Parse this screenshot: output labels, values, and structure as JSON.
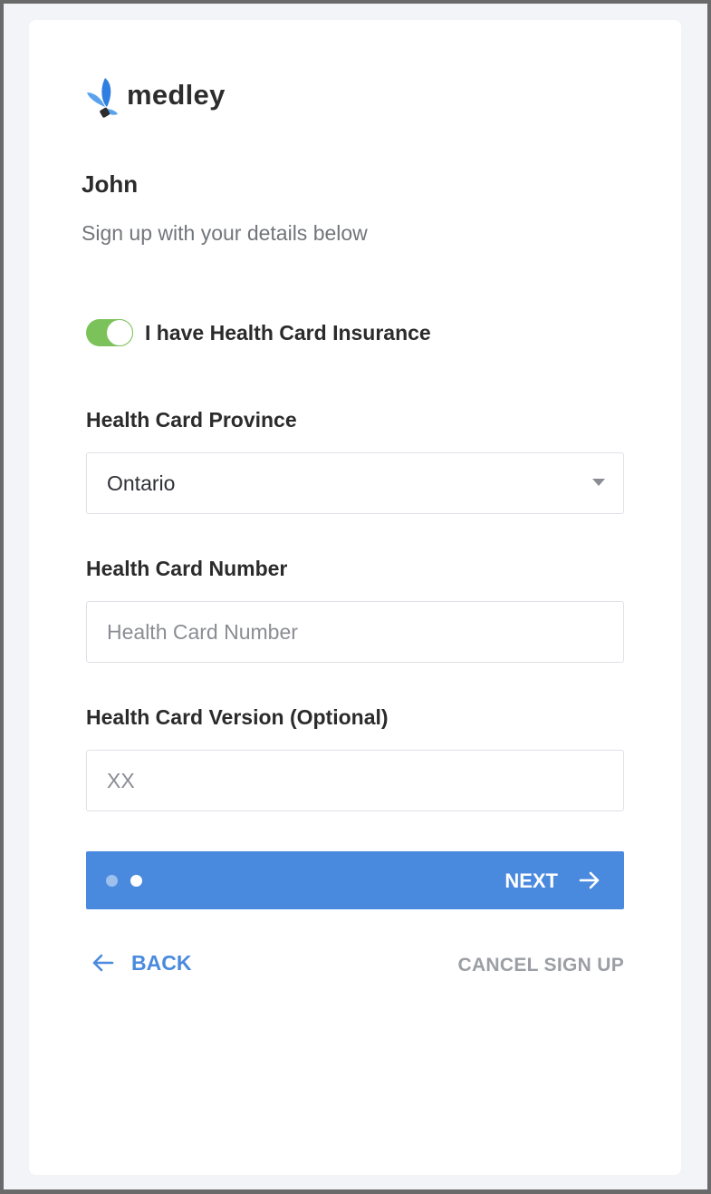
{
  "brand": {
    "name": "medley",
    "accent": "#4a8ade",
    "toggle_on_color": "#7cc25a"
  },
  "header": {
    "user_name": "John",
    "subtitle": "Sign up with your details below"
  },
  "insurance_toggle": {
    "label": "I have Health Card Insurance",
    "checked": true
  },
  "fields": {
    "province": {
      "label": "Health Card Province",
      "value": "Ontario"
    },
    "number": {
      "label": "Health Card Number",
      "placeholder": "Health Card Number",
      "value": ""
    },
    "version": {
      "label": "Health Card Version (Optional)",
      "placeholder": "XX",
      "value": ""
    }
  },
  "stepper": {
    "current_step": 2,
    "total_steps": 2
  },
  "actions": {
    "next_label": "NEXT",
    "back_label": "BACK",
    "cancel_label": "CANCEL SIGN UP"
  }
}
